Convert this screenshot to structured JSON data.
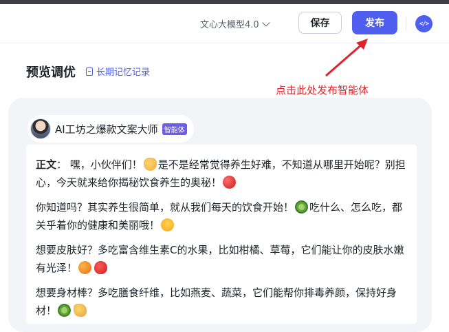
{
  "header": {
    "model_label": "文心大模型4.0",
    "save_label": "保存",
    "publish_label": "发布"
  },
  "preview": {
    "title": "预览调优",
    "memory_link": "长期记忆记录"
  },
  "annotation": {
    "text": "点击此处发布智能体"
  },
  "bot": {
    "name": "AI工坊之爆款文案大师",
    "badge": "智能体"
  },
  "message": {
    "label": "正文",
    "p1": "： 嘿，小伙伴们！",
    "p1b": "是不是经常觉得养生好难，不知道从哪里开始呢？别担心，今天就来给你揭秘饮食养生的奥秘！",
    "p2": "你知道吗？其实养生很简单，就从我们每天的饮食开始！",
    "p2b": "吃什么、怎么吃，都关乎着你的健康和美丽哦！",
    "p3": "想要皮肤好？多吃富含维生素C的水果，比如柑橘、草莓，它们能让你的皮肤水嫩有光泽！",
    "p4": "想要身材棒？多吃膳食纤维，比如燕麦、蔬菜，它们能帮你排毒养颜，保持好身材！"
  },
  "colors": {
    "accent": "#4e5ff0",
    "annotation": "#e0232a",
    "badge": "#6d5ce8"
  }
}
